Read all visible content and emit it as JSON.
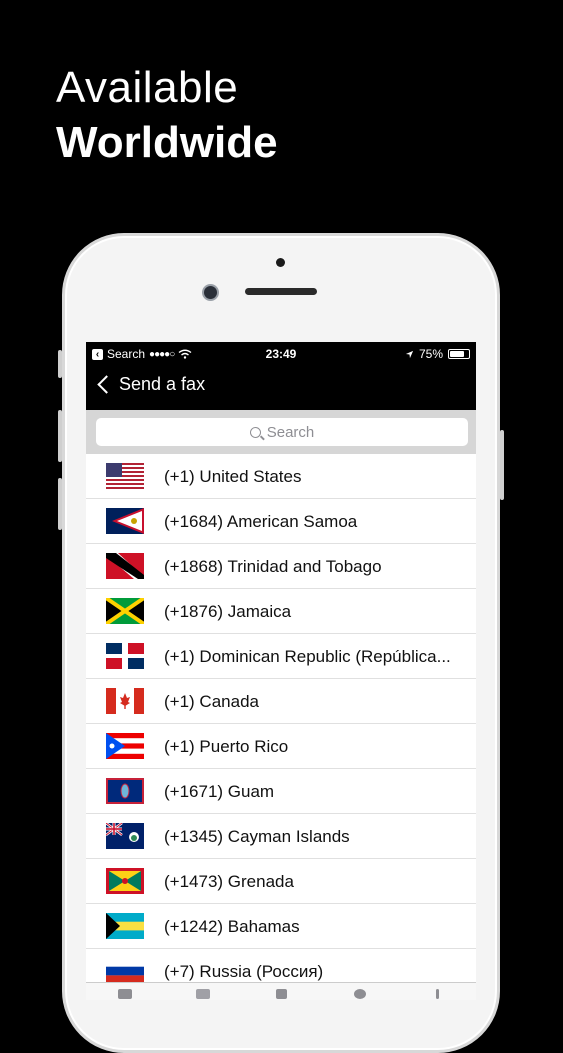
{
  "headline": {
    "line1": "Available",
    "line2": "Worldwide"
  },
  "status_bar": {
    "back_app": "Search",
    "time": "23:49",
    "battery": "75%"
  },
  "nav": {
    "back_label": "Send a fax"
  },
  "search": {
    "placeholder": "Search"
  },
  "countries": [
    {
      "label": "(+1) United States",
      "flag": "us-flag"
    },
    {
      "label": "(+1684) American Samoa",
      "flag": "american-samoa-flag"
    },
    {
      "label": "(+1868) Trinidad and Tobago",
      "flag": "trinidad-flag"
    },
    {
      "label": "(+1876) Jamaica",
      "flag": "jamaica-flag"
    },
    {
      "label": "(+1) Dominican Republic (República...",
      "flag": "dominican-flag"
    },
    {
      "label": "(+1) Canada",
      "flag": "canada-flag"
    },
    {
      "label": "(+1) Puerto Rico",
      "flag": "puerto-rico-flag"
    },
    {
      "label": "(+1671) Guam",
      "flag": "guam-flag"
    },
    {
      "label": "(+1345) Cayman Islands",
      "flag": "cayman-flag"
    },
    {
      "label": "(+1473) Grenada",
      "flag": "grenada-flag"
    },
    {
      "label": "(+1242) Bahamas",
      "flag": "bahamas-flag"
    },
    {
      "label": "(+7) Russia (Россия)",
      "flag": "russia-flag"
    }
  ],
  "tab_icons": [
    "fax-tab-icon",
    "send-tab-icon",
    "document-tab-icon",
    "history-tab-icon",
    "info-tab-icon"
  ]
}
